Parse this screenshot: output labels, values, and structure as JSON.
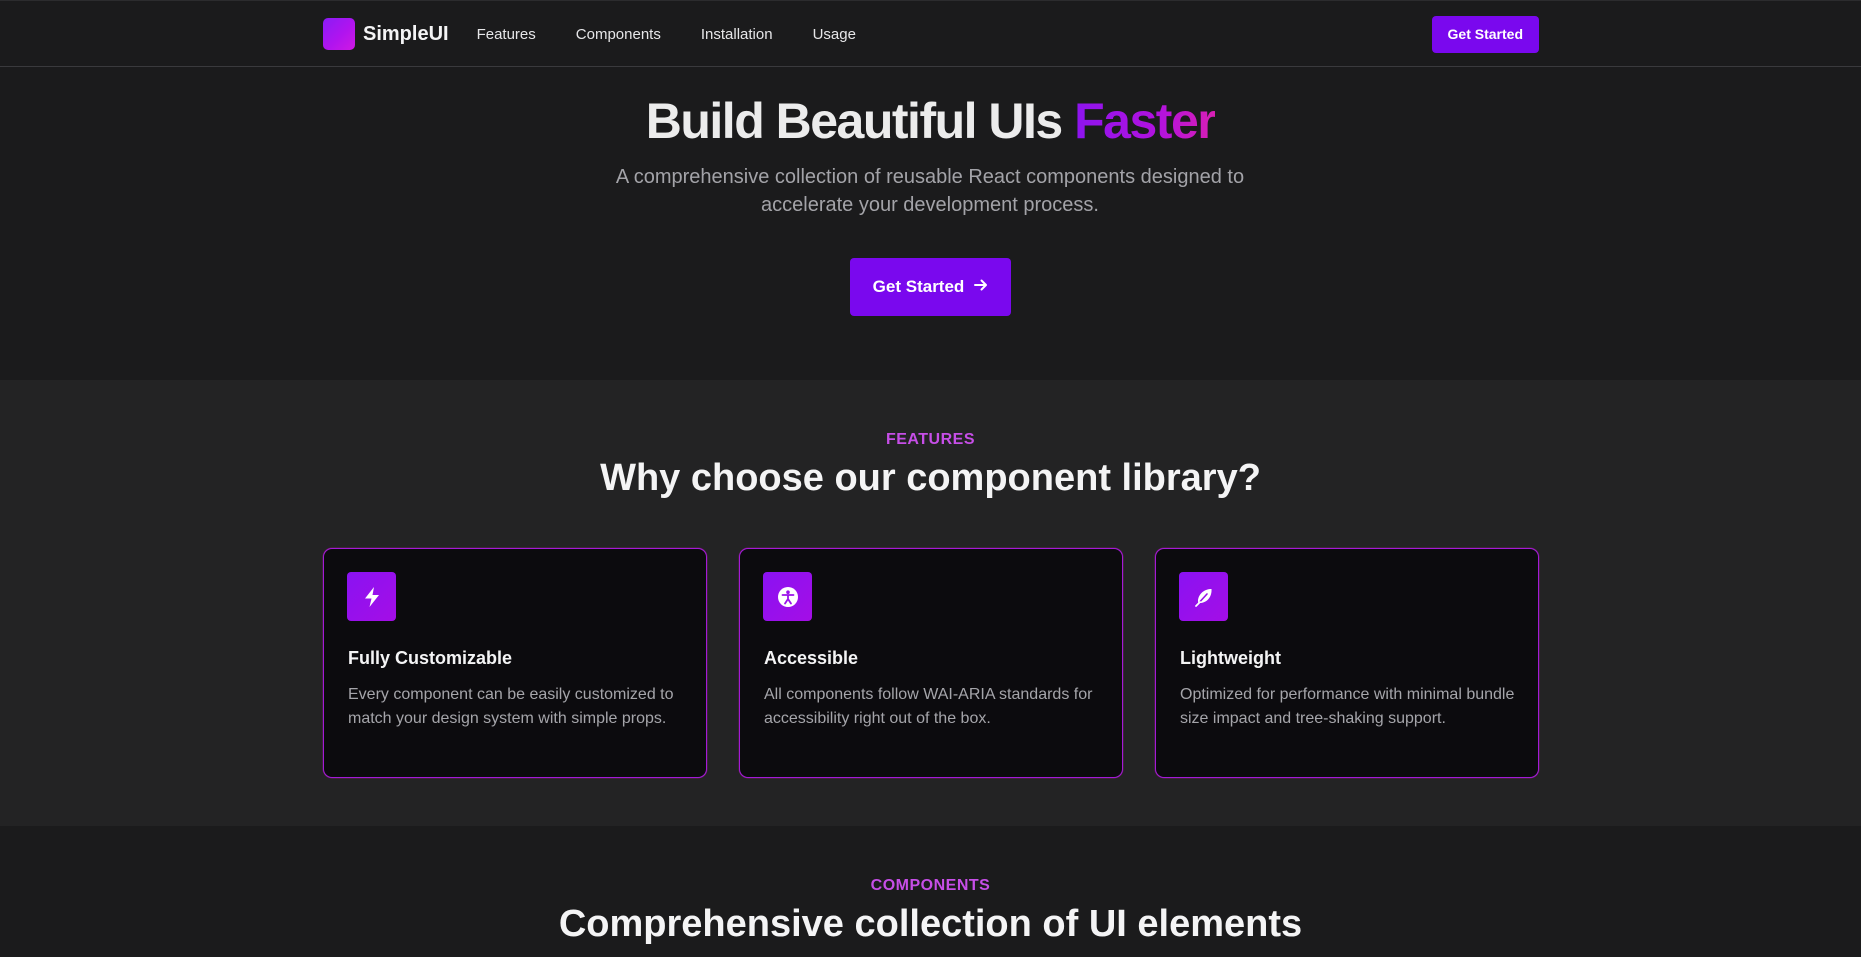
{
  "nav": {
    "logo_text": "SimpleUI",
    "links": [
      "Features",
      "Components",
      "Installation",
      "Usage"
    ],
    "cta_label": "Get Started"
  },
  "hero": {
    "title_main": "Build Beautiful UIs",
    "title_accent": "Faster",
    "subtitle": "A comprehensive collection of reusable React components designed to accelerate your development process.",
    "cta_label": "Get Started",
    "cta_icon": "arrow-right-icon"
  },
  "features": {
    "eyebrow": "FEATURES",
    "title": "Why choose our component library?",
    "cards": [
      {
        "icon": "lightning-bolt-icon",
        "title": "Fully Customizable",
        "description": "Every component can be easily customized to match your design system with simple props."
      },
      {
        "icon": "accessibility-icon",
        "title": "Accessible",
        "description": "All components follow WAI-ARIA standards for accessibility right out of the box."
      },
      {
        "icon": "feather-icon",
        "title": "Lightweight",
        "description": "Optimized for performance with minimal bundle size impact and tree-shaking support."
      }
    ]
  },
  "components": {
    "eyebrow": "COMPONENTS",
    "title": "Comprehensive collection of UI elements"
  },
  "colors": {
    "background": "#1b1b1c",
    "section_background": "#232324",
    "card_background": "#0c0b0e",
    "accent_purple": "#7a08ee",
    "accent_magenta": "#d81fb4",
    "eyebrow_pink": "#c64ee7",
    "muted_text": "#a3a3a8"
  }
}
